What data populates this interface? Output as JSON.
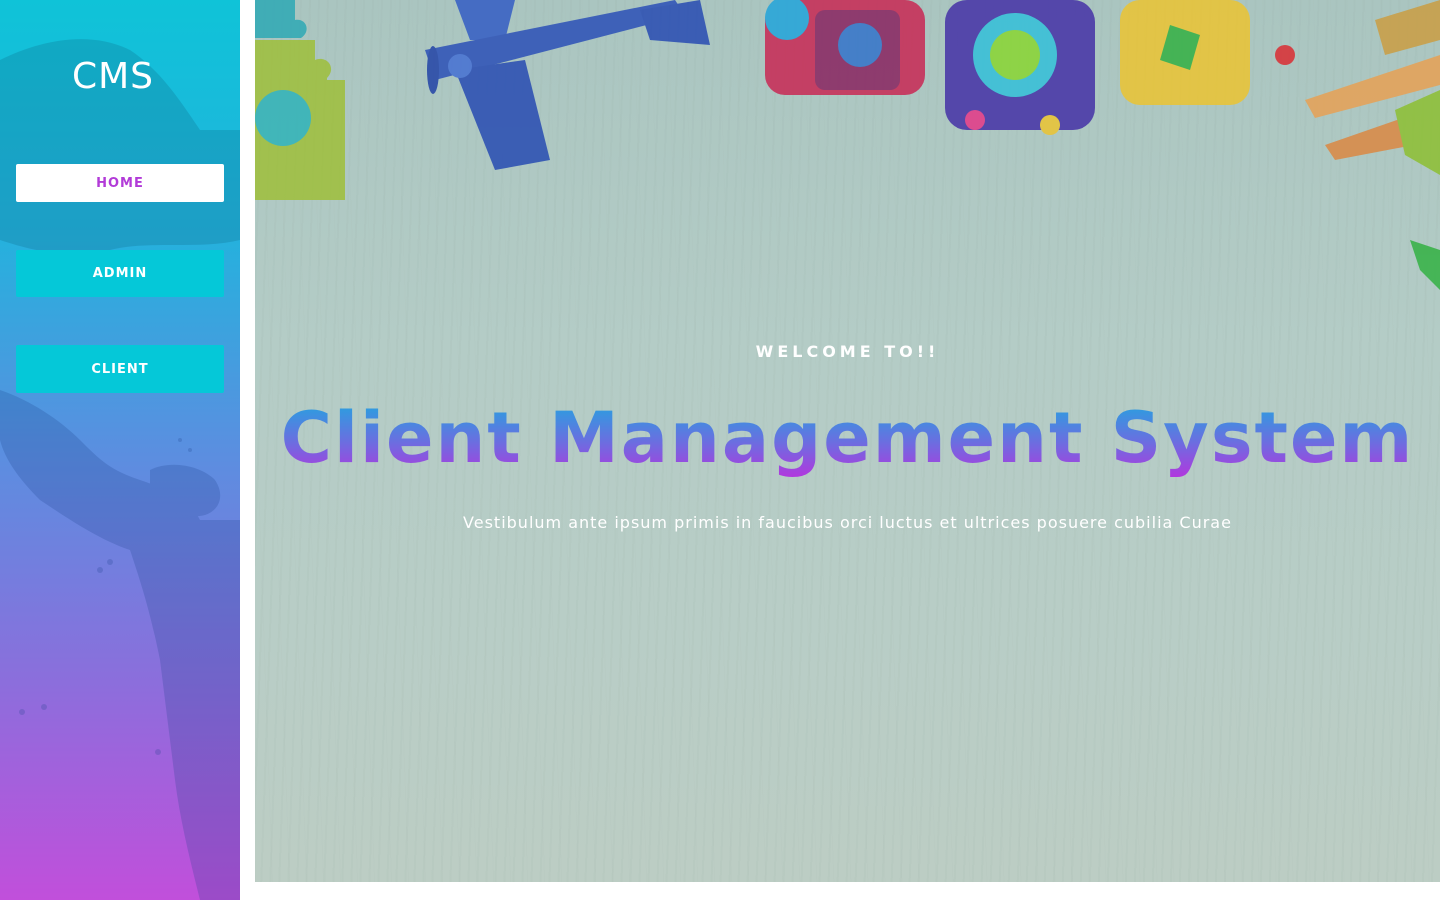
{
  "sidebar": {
    "brand": "CMS",
    "nav": [
      {
        "label": "HOME",
        "active": true
      },
      {
        "label": "ADMIN",
        "active": false
      },
      {
        "label": "CLIENT",
        "active": false
      }
    ]
  },
  "hero": {
    "eyebrow": "WELCOME TO!!",
    "title": "Client Management System",
    "subtitle": "Vestibulum ante ipsum primis in faucibus orci luctus et ultrices posuere cubilia Curae"
  },
  "colors": {
    "sidebar_top": "#0fc3d8",
    "sidebar_bottom": "#c14fdb",
    "nav_button": "#05c8d8",
    "active_text": "#b23bd8",
    "title_gradient_top": "#1ea9df",
    "title_gradient_bottom": "#b535de"
  },
  "icons": {
    "background": "toys-on-wood-table-image",
    "sidebar_background": "world-map-image"
  }
}
